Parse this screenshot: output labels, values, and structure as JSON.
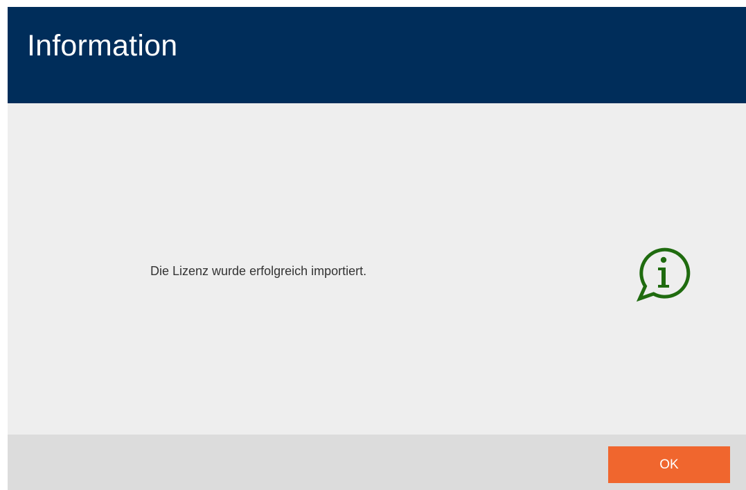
{
  "dialog": {
    "title": "Information",
    "message": "Die Lizenz wurde erfolgreich importiert.",
    "icon": "info-speech-bubble-icon",
    "ok_label": "OK"
  },
  "colors": {
    "header_background": "#002d5a",
    "body_background": "#eeeeee",
    "footer_background": "#dcdcdc",
    "icon_color": "#1f6b0f",
    "ok_button_background": "#f0662e"
  }
}
